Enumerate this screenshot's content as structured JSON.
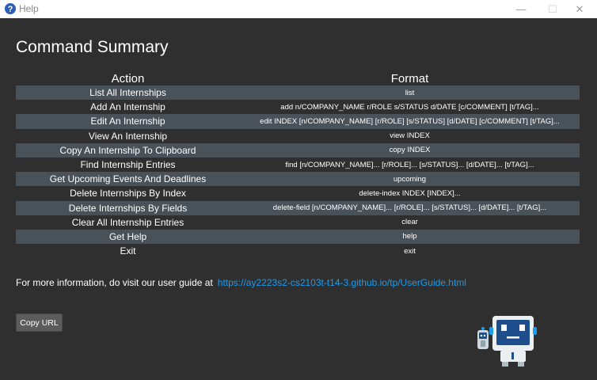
{
  "window": {
    "title": "Help",
    "icons": {
      "app": "help-icon",
      "minimize": "minimize-icon",
      "maximize": "maximize-icon",
      "close": "close-icon"
    },
    "min_glyph": "—",
    "max_glyph": "☐",
    "close_glyph": "✕"
  },
  "heading": "Command Summary",
  "table": {
    "headers": {
      "action": "Action",
      "format": "Format"
    },
    "rows": [
      {
        "action": "List All Internships",
        "format": "list"
      },
      {
        "action": "Add An Internship",
        "format": "add n/COMPANY_NAME r/ROLE s/STATUS d/DATE [c/COMMENT] [t/TAG]..."
      },
      {
        "action": "Edit An Internship",
        "format": "edit INDEX [n/COMPANY_NAME] [r/ROLE] [s/STATUS] [d/DATE] [c/COMMENT] [t/TAG]..."
      },
      {
        "action": "View An Internship",
        "format": "view INDEX"
      },
      {
        "action": "Copy An Internship To Clipboard",
        "format": "copy INDEX"
      },
      {
        "action": "Find Internship Entries",
        "format": "find [n/COMPANY_NAME]... [r/ROLE]... [s/STATUS]... [d/DATE]... [t/TAG]..."
      },
      {
        "action": "Get Upcoming Events And Deadlines",
        "format": "upcoming"
      },
      {
        "action": "Delete Internships By Index",
        "format": "delete-index INDEX [INDEX]..."
      },
      {
        "action": "Delete Internships By Fields",
        "format": "delete-field [n/COMPANY_NAME]... [r/ROLE]... [s/STATUS]... [d/DATE]... [t/TAG]..."
      },
      {
        "action": "Clear All Internship Entries",
        "format": "clear"
      },
      {
        "action": "Get Help",
        "format": "help"
      },
      {
        "action": "Exit",
        "format": "exit"
      }
    ]
  },
  "info": {
    "text": "For more information, do visit our user guide at",
    "url": "https://ay2223s2-cs2103t-t14-3.github.io/tp/UserGuide.html"
  },
  "copy_button": "Copy URL",
  "mascot": "robot-mascot-icon",
  "colors": {
    "background": "#2f2f2f",
    "row_alt": "#4a5259",
    "link": "#1a9cf0",
    "button": "#5c5c5c"
  }
}
